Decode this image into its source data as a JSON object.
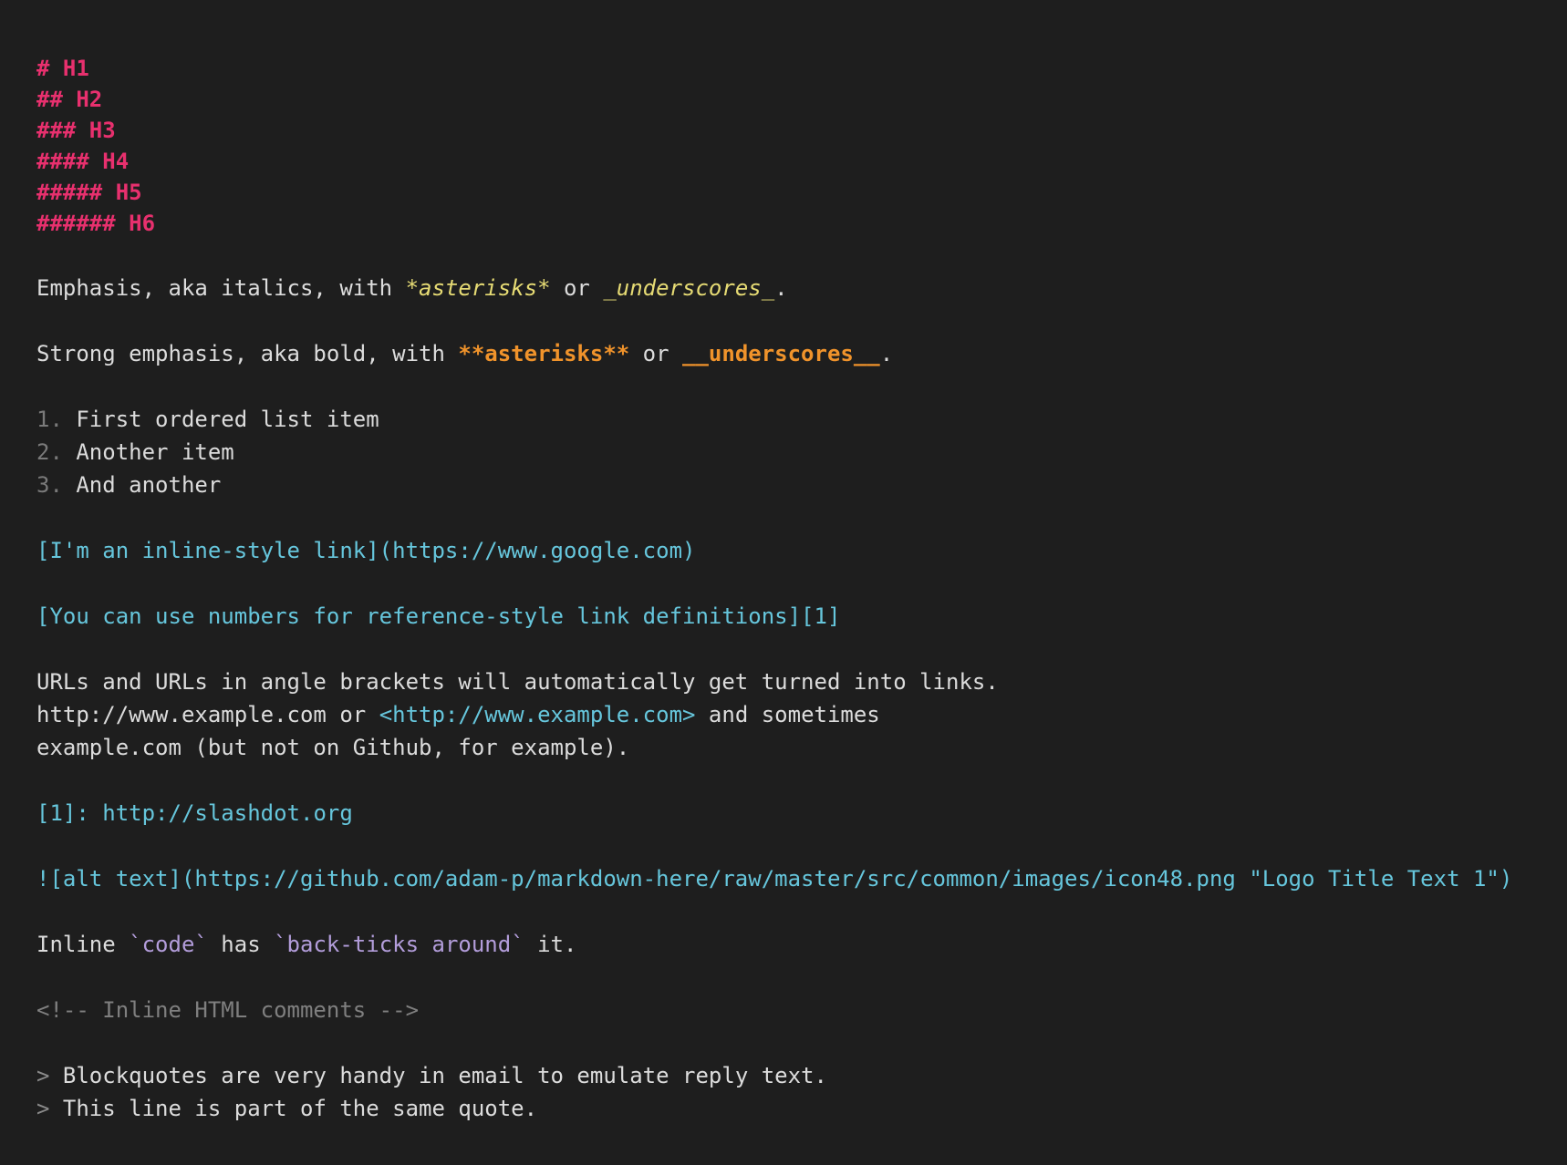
{
  "colors": {
    "background": "#1e1e1e",
    "heading": "#e8306e",
    "text": "#dcdcdc",
    "italic": "#e6db74",
    "bold": "#f0932b",
    "link": "#66c6dc",
    "code": "#b39ddb",
    "comment": "#7f7f7f"
  },
  "headings": [
    "# H1",
    "## H2",
    "### H3",
    "#### H4",
    "##### H5",
    "###### H6"
  ],
  "emphasis": {
    "prefix": "Emphasis, aka italics, with ",
    "asterisks": "*asterisks*",
    "or": " or ",
    "underscores": "_underscores_",
    "end": "."
  },
  "strong": {
    "prefix": "Strong emphasis, aka bold, with ",
    "asterisks": "**asterisks**",
    "or": " or ",
    "underscores": "__underscores__",
    "end": "."
  },
  "list": [
    {
      "num": "1.",
      "text": " First ordered list item"
    },
    {
      "num": "2.",
      "text": " Another item"
    },
    {
      "num": "3.",
      "text": " And another"
    }
  ],
  "inline_link": "[I'm an inline-style link](https://www.google.com)",
  "reference_link": "[You can use numbers for reference-style link definitions][1]",
  "urls": {
    "line1": "URLs and URLs in angle brackets will automatically get turned into links.",
    "line2_a": "http://www.example.com or ",
    "line2_link": "<http://www.example.com>",
    "line2_b": " and sometimes",
    "line3": "example.com (but not on Github, for example)."
  },
  "ref_def": {
    "label": "[1]: ",
    "url": "http://slashdot.org"
  },
  "image": "![alt text](https://github.com/adam-p/markdown-here/raw/master/src/common/images/icon48.png \"Logo Title Text 1\")",
  "inline_code": {
    "a": "Inline ",
    "code1": "`code`",
    "b": " has ",
    "code2": "`back-ticks around`",
    "c": " it."
  },
  "comment": "<!-- Inline HTML comments -->",
  "blockquote": [
    {
      "mark": ">",
      "text": " Blockquotes are very handy in email to emulate reply text."
    },
    {
      "mark": ">",
      "text": " This line is part of the same quote."
    }
  ]
}
